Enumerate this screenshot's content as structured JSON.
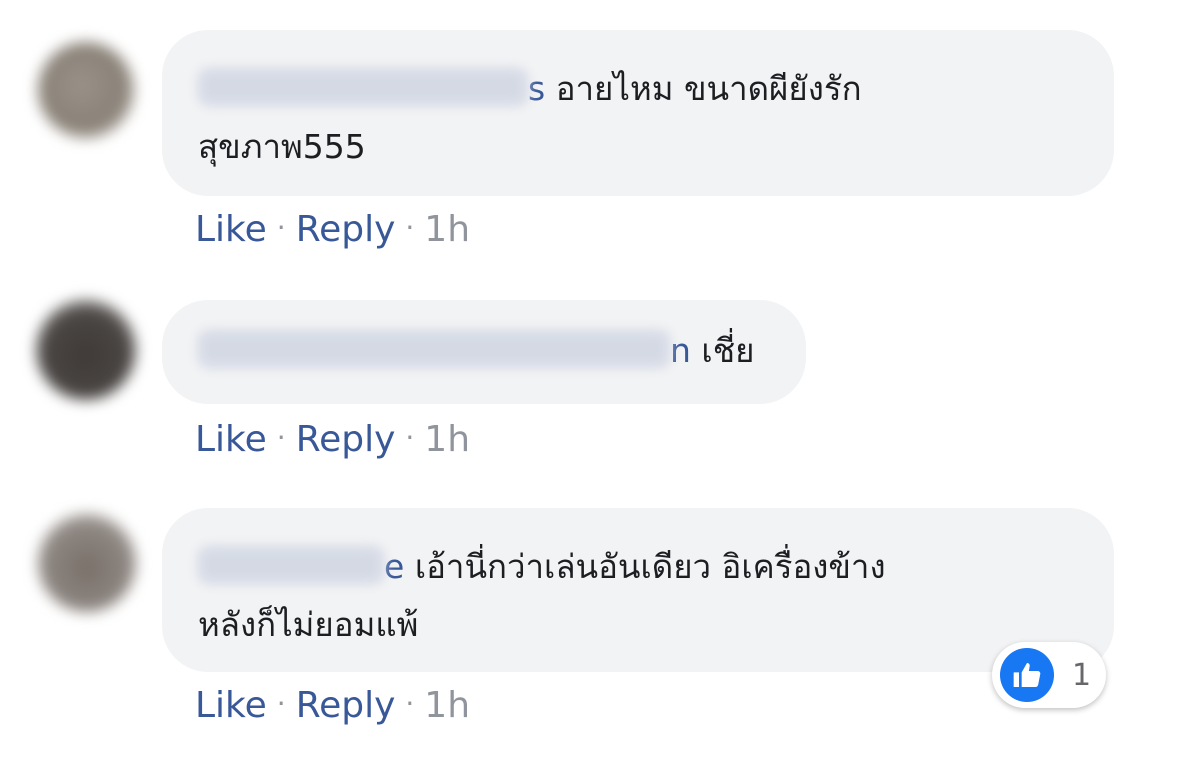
{
  "actions": {
    "like_label": "Like",
    "reply_label": "Reply",
    "separator": "·"
  },
  "comments": [
    {
      "author_tail": "s",
      "text": "อายไหม ขนาดผียังรัก\nสุขภาพ555",
      "time": "1h"
    },
    {
      "author_tail": "n",
      "text": "เชี่ย",
      "time": "1h"
    },
    {
      "author_tail": "e",
      "text": "เอ้านี่กว่าเล่นอันเดียว อิเครื่องข้าง\nหลังก็ไม่ยอมแพ้",
      "time": "1h",
      "reactions": {
        "icon": "like-icon",
        "count": "1",
        "color": "#1877f2"
      }
    }
  ]
}
